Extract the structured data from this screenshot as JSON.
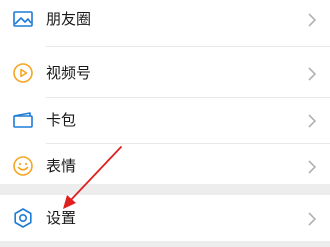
{
  "menu": {
    "items": [
      {
        "label": "朋友圈",
        "icon": "image-icon"
      },
      {
        "label": "视频号",
        "icon": "play-circle-icon"
      },
      {
        "label": "卡包",
        "icon": "card-pack-icon"
      },
      {
        "label": "表情",
        "icon": "smiley-icon"
      }
    ]
  },
  "settings": {
    "label": "设置",
    "icon": "gear-icon"
  },
  "colors": {
    "blue_icon": "#1f7bd6",
    "orange_icon": "#f6a623",
    "annotation_arrow": "#e02020",
    "group_gap": "#ededed"
  }
}
